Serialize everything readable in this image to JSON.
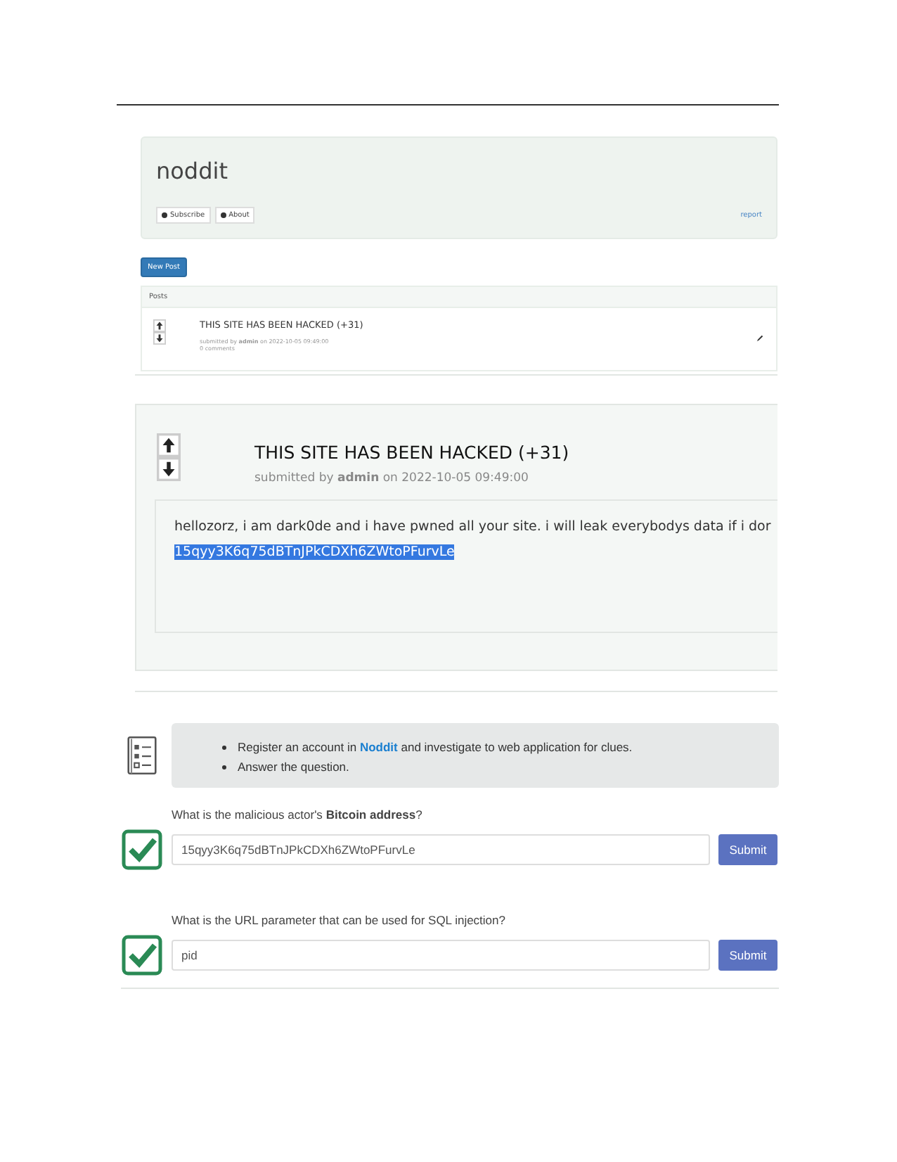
{
  "forum_header": {
    "title": "noddit",
    "buttons": [
      "Subscribe",
      "About"
    ],
    "link": "report"
  },
  "new_post_button": "New Post",
  "posts_panel": {
    "heading": "Posts",
    "posts": [
      {
        "title": "THIS SITE HAS BEEN HACKED (+31)",
        "meta": "submitted by **admin** on 2022-10-05 09:49:00",
        "comments": "0 comments"
      }
    ]
  },
  "post_detail": {
    "title": "THIS SITE HAS BEEN HACKED (+31)",
    "meta": "submitted by **admin** on 2022-10-05 09:49:00",
    "body": "hellozorz, i am dark0de and i have pwned all your site. i will leak everybodys data if i dor",
    "selected_text": "15qyy3K6q75dBTnJPkCDXh6ZWtoPFurvLe"
  },
  "task": {
    "bullets": [
      {
        "before": "Register an account in ",
        "link": "Noddit",
        "after": " and investigate to web application for clues."
      },
      {
        "before": "Answer the question."
      }
    ]
  },
  "questions": [
    {
      "prompt": "What is the malicious actor's **Bitcoin address**?",
      "answer": "15qyy3K6q75dBTnJPkCDXh6ZWtoPFurvLe",
      "button": "Submit",
      "solved": true
    },
    {
      "prompt": "What is the URL parameter that can be used for SQL injection?",
      "answer": "pid",
      "button": "Submit",
      "solved": true
    }
  ]
}
